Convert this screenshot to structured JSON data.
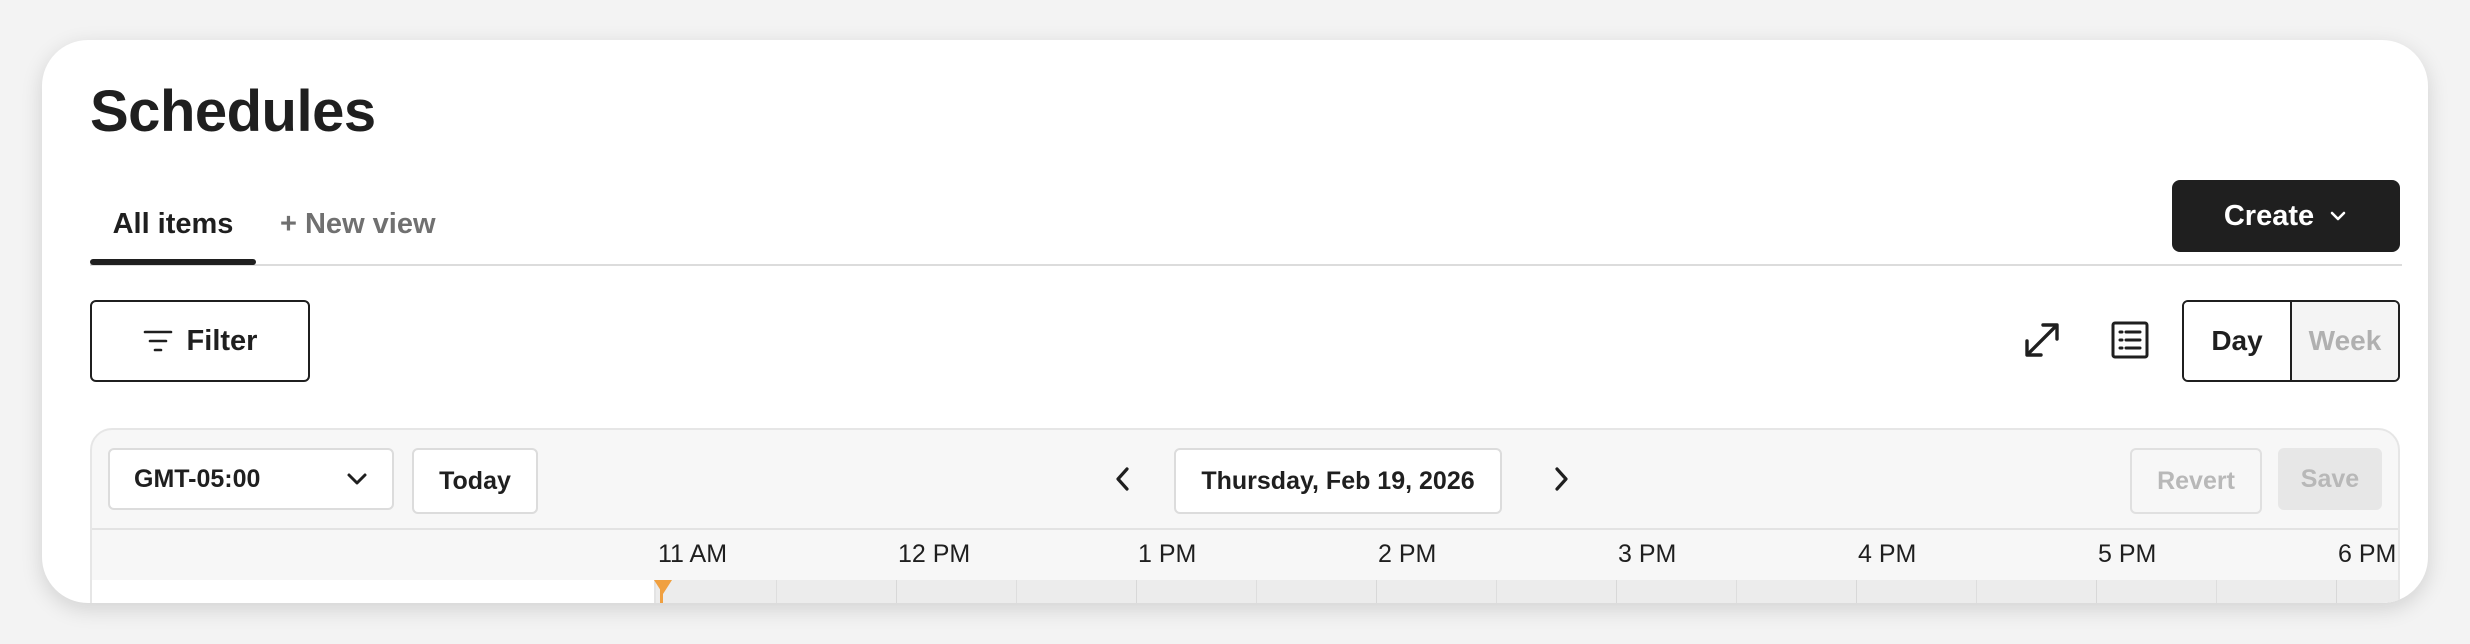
{
  "page": {
    "title": "Schedules"
  },
  "tabs": [
    {
      "label": "All items",
      "active": true
    },
    {
      "label": "+ New view",
      "active": false
    }
  ],
  "toolbar": {
    "create_label": "Create",
    "filter_label": "Filter",
    "view_toggle": {
      "day": "Day",
      "week": "Week",
      "selected": "Day"
    }
  },
  "calendar": {
    "timezone": "GMT-05:00",
    "today_label": "Today",
    "date": "Thursday, Feb 19, 2026",
    "revert_label": "Revert",
    "save_label": "Save",
    "hours": [
      "11 AM",
      "12 PM",
      "1 PM",
      "2 PM",
      "3 PM",
      "4 PM",
      "5 PM",
      "6 PM"
    ]
  },
  "colors": {
    "accent": "#1f1f1f",
    "now_marker": "#f0a040"
  },
  "icons": {
    "filter": "filter-lines-icon",
    "expand": "expand-arrows-icon",
    "list": "list-view-icon",
    "chevron": "chevron-down-icon"
  }
}
